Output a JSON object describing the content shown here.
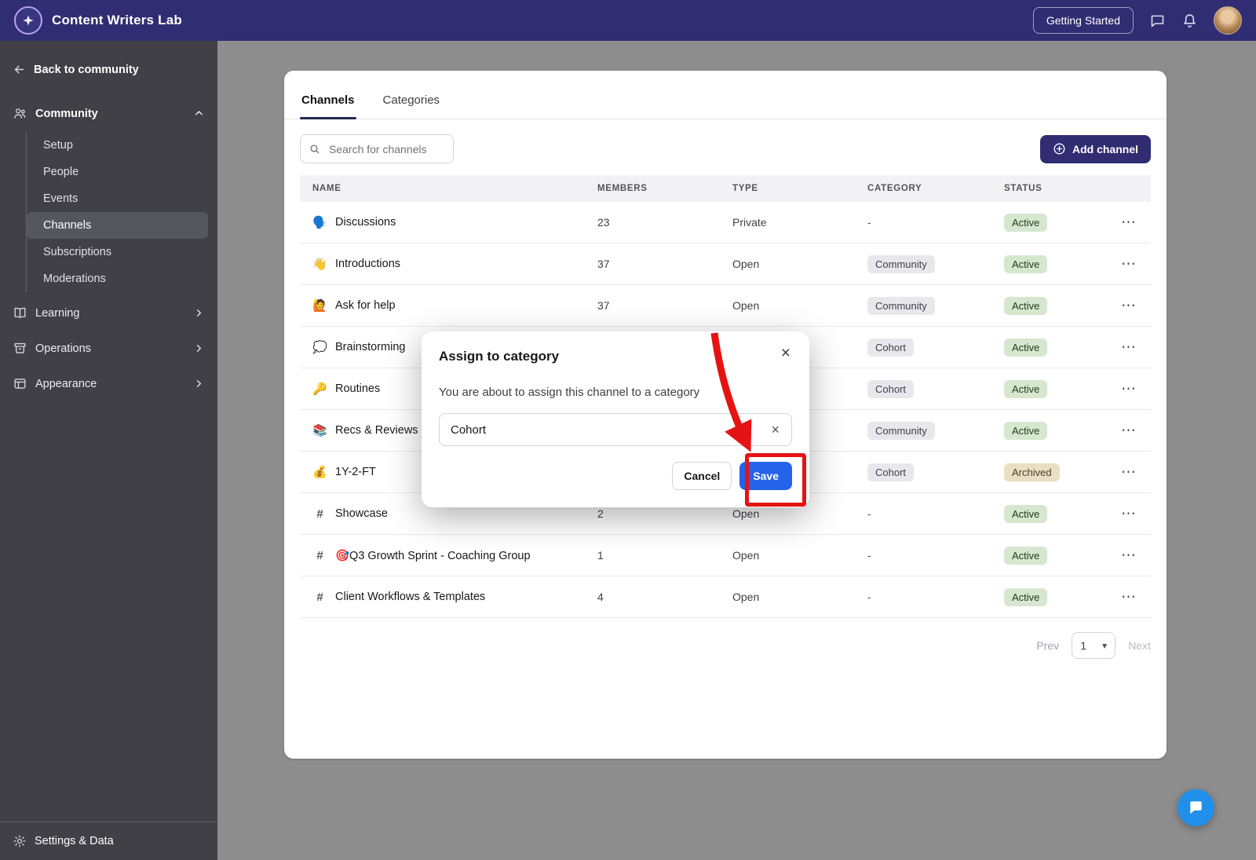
{
  "topbar": {
    "brand": "Content Writers Lab",
    "getting_started_label": "Getting Started"
  },
  "sidebar": {
    "back_label": "Back to community",
    "community_label": "Community",
    "community_items": [
      "Setup",
      "People",
      "Events",
      "Channels",
      "Subscriptions",
      "Moderations"
    ],
    "active_item": "Channels",
    "groups": [
      "Learning",
      "Operations",
      "Appearance"
    ],
    "settings_label": "Settings & Data"
  },
  "main": {
    "tabs": [
      {
        "label": "Channels",
        "active": true
      },
      {
        "label": "Categories",
        "active": false
      }
    ],
    "search_placeholder": "Search for channels",
    "add_channel_label": "Add channel",
    "table": {
      "headers": [
        "NAME",
        "MEMBERS",
        "TYPE",
        "CATEGORY",
        "STATUS"
      ],
      "rows": [
        {
          "icon": "🗣️",
          "name": "Discussions",
          "members": "23",
          "type": "Private",
          "category": "-",
          "category_pill": false,
          "status": "Active",
          "status_kind": "active"
        },
        {
          "icon": "👋",
          "name": "Introductions",
          "members": "37",
          "type": "Open",
          "category": "Community",
          "category_pill": true,
          "status": "Active",
          "status_kind": "active"
        },
        {
          "icon": "🙋",
          "name": "Ask for help",
          "members": "37",
          "type": "Open",
          "category": "Community",
          "category_pill": true,
          "status": "Active",
          "status_kind": "active"
        },
        {
          "icon": "💭",
          "name": "Brainstorming",
          "members": "",
          "type": "",
          "category": "Cohort",
          "category_pill": true,
          "status": "Active",
          "status_kind": "active"
        },
        {
          "icon": "🔑",
          "name": "Routines",
          "members": "",
          "type": "",
          "category": "Cohort",
          "category_pill": true,
          "status": "Active",
          "status_kind": "active"
        },
        {
          "icon": "📚",
          "name": "Recs & Reviews",
          "members": "",
          "type": "",
          "category": "Community",
          "category_pill": true,
          "status": "Active",
          "status_kind": "active"
        },
        {
          "icon": "💰",
          "name": "1Y-2-FT",
          "members": "",
          "type": "",
          "category": "Cohort",
          "category_pill": true,
          "status": "Archived",
          "status_kind": "archived"
        },
        {
          "icon": "#",
          "name": "Showcase",
          "members": "2",
          "type": "Open",
          "category": "-",
          "category_pill": false,
          "status": "Active",
          "status_kind": "active"
        },
        {
          "icon": "#",
          "name": "🎯Q3 Growth Sprint - Coaching Group",
          "members": "1",
          "type": "Open",
          "category": "-",
          "category_pill": false,
          "status": "Active",
          "status_kind": "active"
        },
        {
          "icon": "#",
          "name": "Client Workflows & Templates",
          "members": "4",
          "type": "Open",
          "category": "-",
          "category_pill": false,
          "status": "Active",
          "status_kind": "active"
        }
      ]
    },
    "pagination": {
      "prev_label": "Prev",
      "page": "1",
      "next_label": "Next"
    }
  },
  "modal": {
    "title": "Assign to category",
    "description": "You are about to assign this channel to a category",
    "input_value": "Cohort",
    "cancel_label": "Cancel",
    "save_label": "Save"
  },
  "icons": {
    "row_menu": "⋯",
    "close": "×",
    "clear": "×",
    "caret": "▾"
  },
  "colors": {
    "topbar_bg": "#302d72",
    "sidebar_bg": "#404046",
    "page_bg": "#8d8d8d",
    "save_button": "#2563eb",
    "add_button": "#302d72",
    "active_badge_bg": "#d6e7cf",
    "archived_badge_bg": "#eadfc2",
    "annotation_red": "#e51313",
    "chat_fab_bg": "#2090ea"
  }
}
